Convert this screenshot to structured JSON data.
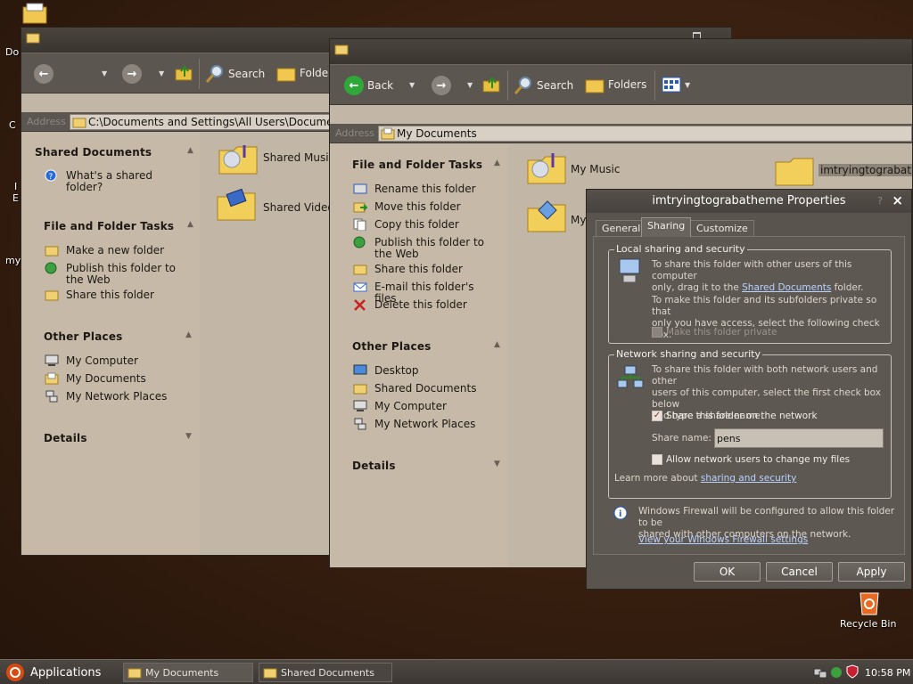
{
  "desktop": {
    "labels": [
      "Do",
      "C",
      "I",
      "E",
      "my"
    ],
    "recycle_bin": "Recycle Bin"
  },
  "back_window": {
    "toolbar": {
      "search": "Search",
      "folders": "Folder"
    },
    "address_label": "Address",
    "address_value": "C:\\Documents and Settings\\All Users\\Documen",
    "sections": {
      "shared_documents": {
        "title": "Shared Documents",
        "items": [
          "What's a shared folder?"
        ]
      },
      "file_tasks": {
        "title": "File and Folder Tasks",
        "items": [
          "Make a new folder",
          "Publish this folder to the Web",
          "Share this folder"
        ]
      },
      "other_places": {
        "title": "Other Places",
        "items": [
          "My Computer",
          "My Documents",
          "My Network Places"
        ]
      },
      "details": {
        "title": "Details"
      }
    },
    "files": [
      "Shared Music",
      "Shared Video"
    ]
  },
  "front_window": {
    "toolbar": {
      "back": "Back",
      "search": "Search",
      "folders": "Folders"
    },
    "address_label": "Address",
    "address_value": "My Documents",
    "sections": {
      "file_tasks": {
        "title": "File and Folder Tasks",
        "items": [
          "Rename this folder",
          "Move this folder",
          "Copy this folder",
          "Publish this folder to the Web",
          "Share this folder",
          "E-mail this folder's files",
          "Delete this folder"
        ]
      },
      "other_places": {
        "title": "Other Places",
        "items": [
          "Desktop",
          "Shared Documents",
          "My Computer",
          "My Network Places"
        ]
      },
      "details": {
        "title": "Details"
      }
    },
    "files": [
      "My Music",
      "My",
      "imtryingtograbatheme"
    ]
  },
  "dialog": {
    "title": "imtryingtograbatheme Properties",
    "tabs": [
      "General",
      "Sharing",
      "Customize"
    ],
    "local": {
      "label": "Local sharing and security",
      "text1a": "To share this folder with other users of this computer",
      "text1b": "only, drag it to the",
      "text1_link": "Shared Documents",
      "text1c": "folder.",
      "text2a": "To make this folder and its subfolders private so that",
      "text2b": "only you have access, select the following check box.",
      "private_cb": "Make this folder private"
    },
    "network": {
      "label": "Network sharing and security",
      "text1a": "To share this folder with both network users and other",
      "text1b": "users of this computer, select the first check box below",
      "text1c": "and type a share name.",
      "share_cb": "Share this folder on the network",
      "share_name_label": "Share name:",
      "share_name_value": "pens",
      "allow_cb": "Allow network users to change my files",
      "learn_text": "Learn more about",
      "learn_link": "sharing and security"
    },
    "firewall": {
      "text1": "Windows Firewall will be configured to allow this folder to be",
      "text2": "shared with other computers on the network.",
      "link": "View your Windows Firewall settings"
    },
    "buttons": {
      "ok": "OK",
      "cancel": "Cancel",
      "apply": "Apply"
    }
  },
  "taskbar": {
    "applications": "Applications",
    "tasks": [
      "My Documents",
      "Shared Documents"
    ],
    "clock": "10:58 PM"
  }
}
